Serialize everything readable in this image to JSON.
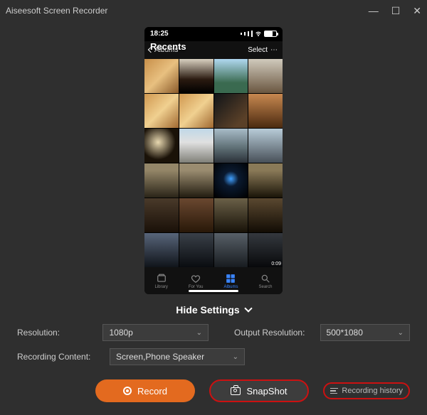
{
  "window": {
    "title": "Aiseesoft Screen Recorder"
  },
  "phone": {
    "time": "18:25",
    "back": "Albums",
    "title": "Recents",
    "select": "Select",
    "video_duration": "0:09",
    "tabs": [
      "Library",
      "For You",
      "Albums",
      "Search"
    ]
  },
  "hide_settings": "Hide Settings",
  "settings": {
    "resolution_label": "Resolution:",
    "resolution_value": "1080p",
    "output_label": "Output Resolution:",
    "output_value": "500*1080",
    "content_label": "Recording Content:",
    "content_value": "Screen,Phone Speaker"
  },
  "actions": {
    "record": "Record",
    "snapshot": "SnapShot",
    "history": "Recording history"
  }
}
